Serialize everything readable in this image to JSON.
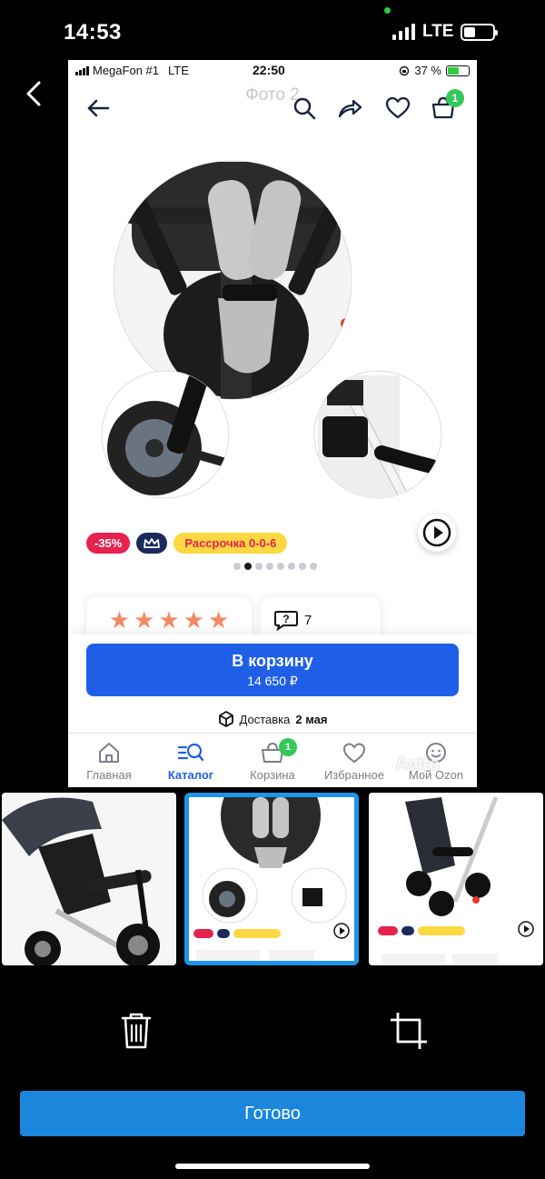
{
  "os_status": {
    "time": "14:53",
    "network": "LTE"
  },
  "inner_app": {
    "status": {
      "carrier": "MegaFon #1",
      "network": "LTE",
      "time": "22:50",
      "battery": "37 %"
    },
    "toolbar": {
      "title": "Фото 2",
      "cart_badge": "1"
    },
    "badges": {
      "discount": "-35%",
      "installment": "Рассрочка 0-0-6"
    },
    "pager": {
      "total": 8,
      "active_index": 1
    },
    "rating": {
      "stars": 5
    },
    "reviews": {
      "count": "7"
    },
    "cart_button": {
      "label": "В корзину",
      "price": "14 650 ₽"
    },
    "delivery": {
      "prefix": "Доставка",
      "date": "2 мая"
    },
    "tabs": [
      {
        "label": "Главная",
        "icon": "home-icon"
      },
      {
        "label": "Каталог",
        "icon": "catalog-search-icon",
        "active": true
      },
      {
        "label": "Корзина",
        "icon": "basket-icon",
        "badge": "1"
      },
      {
        "label": "Избранное",
        "icon": "heart-icon"
      },
      {
        "label": "Мой Ozon",
        "icon": "smiley-icon"
      }
    ],
    "watermark": "Avito"
  },
  "thumbnails": {
    "selected_index": 1,
    "count": 3
  },
  "actions": {
    "done_label": "Готово"
  },
  "colors": {
    "accent_blue": "#1f5fe8",
    "done_blue": "#1a86dc",
    "badge_green": "#34c759",
    "discount_red": "#e5234e",
    "installment_yellow": "#fcd842"
  }
}
